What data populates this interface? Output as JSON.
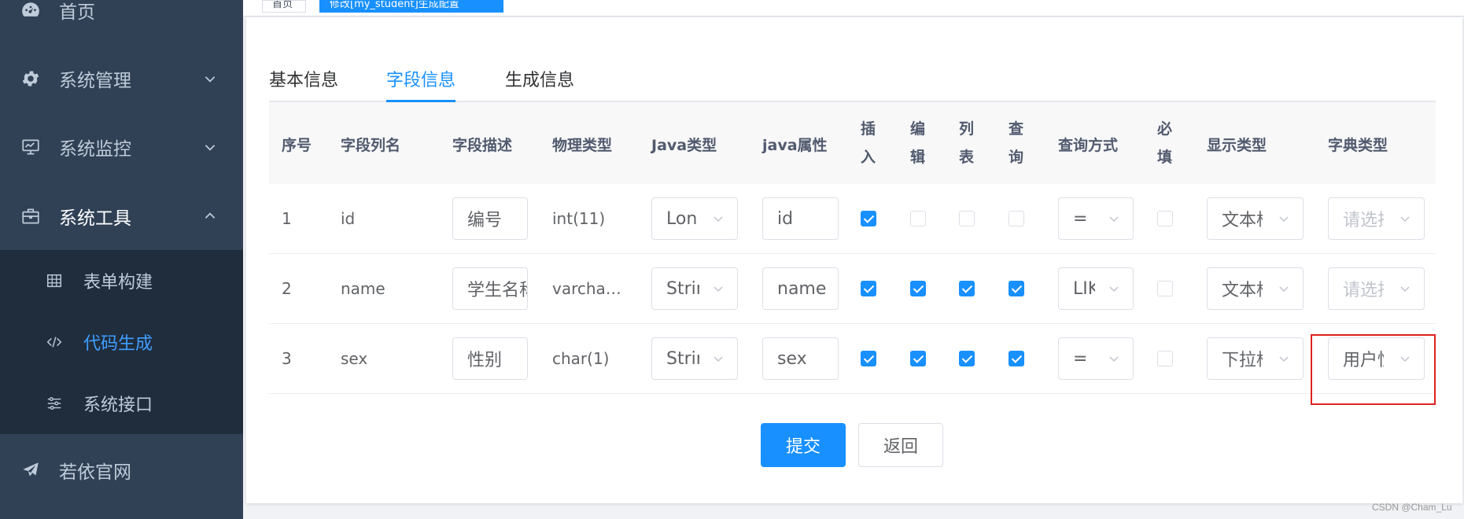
{
  "sidebar": {
    "items": [
      {
        "label": "首页",
        "icon": "dashboard-icon"
      },
      {
        "label": "系统管理",
        "icon": "gear-icon"
      },
      {
        "label": "系统监控",
        "icon": "monitor-icon"
      },
      {
        "label": "系统工具",
        "icon": "toolbox-icon"
      }
    ],
    "submenu": [
      {
        "label": "表单构建",
        "icon": "table-icon"
      },
      {
        "label": "代码生成",
        "icon": "code-icon"
      },
      {
        "label": "系统接口",
        "icon": "sliders-icon"
      }
    ],
    "after": {
      "label": "若依官网",
      "icon": "send-icon"
    }
  },
  "tags": {
    "home": "首页",
    "active": "修改[my_student]生成配置"
  },
  "tabs": [
    "基本信息",
    "字段信息",
    "生成信息"
  ],
  "table": {
    "headers": {
      "seq": "序号",
      "colname": "字段列名",
      "desc": "字段描述",
      "phys": "物理类型",
      "javatype": "Java类型",
      "javaprop": "java属性",
      "insert": [
        "插",
        "入"
      ],
      "edit": [
        "编",
        "辑"
      ],
      "list": [
        "列",
        "表"
      ],
      "query": [
        "查",
        "询"
      ],
      "querytype": "查询方式",
      "required": [
        "必",
        "填"
      ],
      "htmltype": "显示类型",
      "dicttype": "字典类型"
    },
    "rows": [
      {
        "seq": "1",
        "colname": "id",
        "desc": "编号",
        "phys": "int(11)",
        "javatype": "Lon",
        "javaprop": "id",
        "querytype": "=",
        "htmltype": "文本框",
        "dicttype": "请选择"
      },
      {
        "seq": "2",
        "colname": "name",
        "desc": "学生名称",
        "phys": "varcha…",
        "javatype": "Strin",
        "javaprop": "name",
        "querytype": "LIKE",
        "htmltype": "文本框",
        "dicttype": "请选择"
      },
      {
        "seq": "3",
        "colname": "sex",
        "desc": "性别",
        "phys": "char(1)",
        "javatype": "Strin",
        "javaprop": "sex",
        "querytype": "=",
        "htmltype": "下拉框",
        "dicttype": "用户性别"
      }
    ]
  },
  "buttons": {
    "submit": "提交",
    "back": "返回"
  },
  "watermark": "CSDN @Cham_Lu",
  "colors": {
    "primary": "#1890ff",
    "sidebar": "#304156",
    "submenu": "#1f2d3d",
    "annotation": "#e02020"
  }
}
